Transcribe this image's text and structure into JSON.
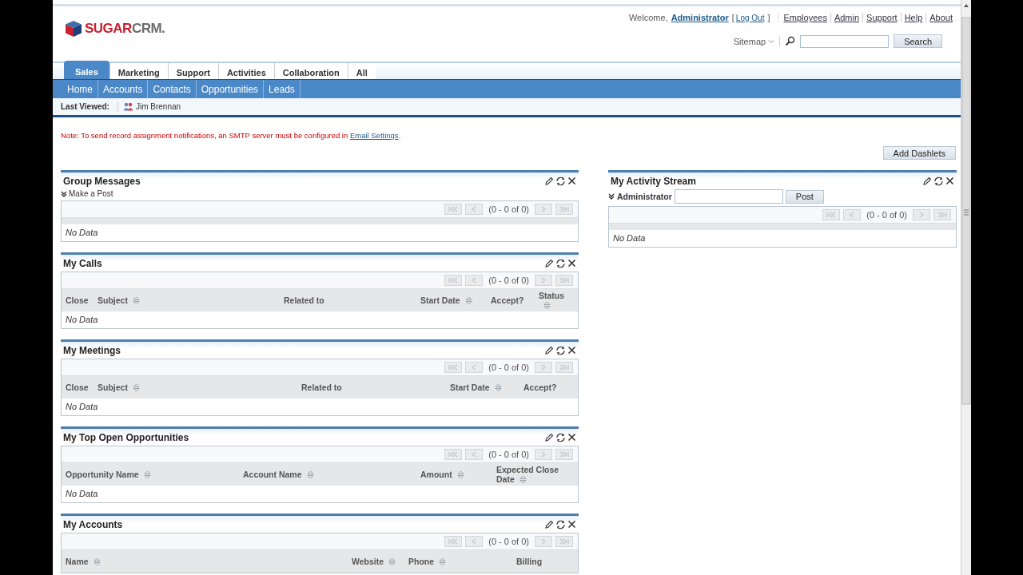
{
  "logo": {
    "parts": [
      "SUGAR",
      "CRM."
    ]
  },
  "user_bar": {
    "welcome": "Welcome,",
    "user": "Administrator",
    "logout": {
      "before": "[",
      "link": "Log Out",
      "after": "]"
    },
    "links": [
      "Employees",
      "Admin",
      "Support",
      "Help",
      "About"
    ]
  },
  "sitemap": "Sitemap",
  "search": {
    "button": "Search"
  },
  "tabs": [
    {
      "label": "Sales",
      "selected": true
    },
    {
      "label": "Marketing",
      "selected": false
    },
    {
      "label": "Support",
      "selected": false
    },
    {
      "label": "Activities",
      "selected": false
    },
    {
      "label": "Collaboration",
      "selected": false
    },
    {
      "label": "All",
      "selected": false
    }
  ],
  "subtabs": [
    "Home",
    "Accounts",
    "Contacts",
    "Opportunities",
    "Leads"
  ],
  "last_viewed": {
    "label": "Last Viewed:",
    "items": [
      "Jim Brennan"
    ]
  },
  "notice": {
    "text": "Note: To send record assignment notifications, an SMTP server must be configured in",
    "link": "Email Settings",
    "end": "."
  },
  "add_dashlets": "Add Dashlets",
  "left_column": {
    "dashlets": [
      {
        "title": "Group Messages",
        "post_toggle": "Make a Post",
        "pager": {
          "range": "(0 - 0 of 0)",
          "disabled": true
        },
        "empty": "No Data"
      },
      {
        "title": "My Calls",
        "pager": {
          "range": "(0 - 0 of 0)",
          "disabled": true
        },
        "columns": [
          {
            "label": "Close",
            "sortable": false
          },
          {
            "label": "Subject",
            "sortable": true
          },
          {
            "label": "Related to",
            "sortable": false
          },
          {
            "label": "Start Date",
            "sortable": true
          },
          {
            "label": "Accept?",
            "sortable": false
          },
          {
            "label": "Status",
            "sortable": true
          }
        ],
        "empty": "No Data"
      },
      {
        "title": "My Meetings",
        "pager": {
          "range": "(0 - 0 of 0)",
          "disabled": true
        },
        "columns": [
          {
            "label": "Close",
            "sortable": false
          },
          {
            "label": "Subject",
            "sortable": true
          },
          {
            "label": "Related to",
            "sortable": false
          },
          {
            "label": "Start Date",
            "sortable": true
          },
          {
            "label": "Accept?",
            "sortable": false
          }
        ],
        "empty": "No Data"
      },
      {
        "title": "My Top Open Opportunities",
        "pager": {
          "range": "(0 - 0 of 0)",
          "disabled": true
        },
        "columns": [
          {
            "label": "Opportunity Name",
            "sortable": true
          },
          {
            "label": "Account Name",
            "sortable": true
          },
          {
            "label": "Amount",
            "sortable": true
          },
          {
            "label": "Expected Close Date",
            "sortable": true
          }
        ],
        "empty": "No Data"
      },
      {
        "title": "My Accounts",
        "pager": {
          "range": "(0 - 0 of 0)",
          "disabled": true
        },
        "columns": [
          {
            "label": "Name",
            "sortable": true
          },
          {
            "label": "Website",
            "sortable": true
          },
          {
            "label": "Phone",
            "sortable": true
          },
          {
            "label": "Billing",
            "sortable": false
          }
        ]
      }
    ]
  },
  "right_column": {
    "dashlets": [
      {
        "title": "My Activity Stream",
        "poster": {
          "label": "Administrator",
          "button": "Post"
        },
        "pager": {
          "range": "(0 - 0 of 0)",
          "disabled": true
        },
        "empty": "No Data"
      }
    ]
  }
}
